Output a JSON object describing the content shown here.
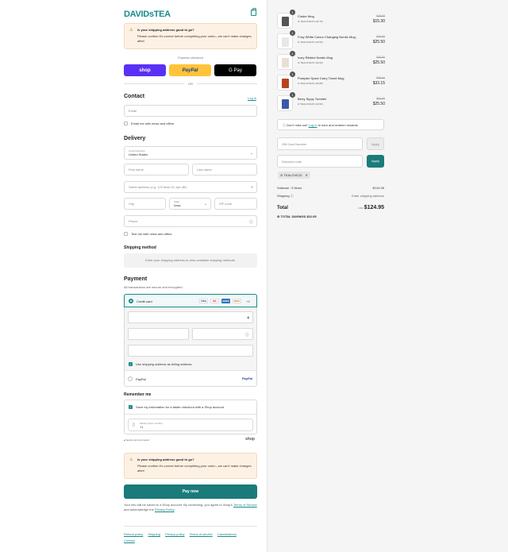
{
  "header": {
    "logo": "DAVIDsTEA",
    "bag_icon": "shopping-bag-icon"
  },
  "warning": {
    "title": "Is your shipping address good to go?",
    "body": "Please confirm it's correct before completing your order—we can't make changes after!"
  },
  "express": {
    "label": "Express checkout",
    "shop": "shop",
    "paypal": "PayPal",
    "gpay": "G Pay",
    "or": "OR"
  },
  "contact": {
    "heading": "Contact",
    "login_link": "Log in",
    "email_placeholder": "Email",
    "email_news": "Email me with news and offers"
  },
  "delivery": {
    "heading": "Delivery",
    "country_label": "Country/Region",
    "country_value": "United States",
    "first_name": "First name",
    "last_name": "Last name",
    "street": "Street address (e.g. 123 Main St, Apt 4B)",
    "city": "City",
    "state_label": "State",
    "state_value": "Iowa",
    "zip": "ZIP code",
    "phone": "Phone",
    "text_news": "Text me with news and offers"
  },
  "shipping": {
    "heading": "Shipping method",
    "empty": "Enter your shipping address to view available shipping methods."
  },
  "payment": {
    "heading": "Payment",
    "subtitle": "All transactions are secure and encrypted.",
    "credit_card": "Credit card",
    "card_logos": [
      "VISA",
      "MC",
      "AMEX",
      "DISC"
    ],
    "more_cards": "+3",
    "billing_same": "Use shipping address as billing address",
    "paypal": "PayPal",
    "paypal_logo": "PayPal"
  },
  "remember": {
    "heading": "Remember me",
    "save_info": "Save my information for a faster checkout with a Shop account",
    "mobile_label": "Mobile phone number",
    "mobile_value": "+1",
    "secure": "Secure and encrypted",
    "shop_logo": "shop"
  },
  "pay_now": "Pay now",
  "legal": {
    "text1": "Your info will be saved to a Shop account. By continuing, you agree to Shop's",
    "terms": "Terms of Service",
    "text2": "and acknowledge the",
    "privacy": "Privacy Policy",
    "end": "."
  },
  "footer": {
    "links": [
      "Refund policy",
      "Shipping",
      "Privacy policy",
      "Terms of service",
      "Cancellations",
      "Contact"
    ]
  },
  "cart": {
    "items": [
      {
        "qty": "1",
        "name": "Cinder Mug",
        "discount": "TEALOVE15 (-$2.70)",
        "original": "$18.00",
        "price": "$15.30",
        "color": "#555555"
      },
      {
        "qty": "1",
        "name": "Foxy White Colour Changing Nordic Mug -",
        "discount": "TEALOVE15 (-$4.50)",
        "original": "$30.00",
        "price": "$25.50",
        "color": "#e8e8e8"
      },
      {
        "qty": "1",
        "name": "Ivory Ribbed Nordic Mug",
        "discount": "TEALOVE15 (-$4.50)",
        "original": "$30.00",
        "price": "$25.50",
        "color": "#e9e1d0"
      },
      {
        "qty": "1",
        "name": "Pumpkin Spice Carry Travel Mug",
        "discount": "TEALOVE15 (-$5.85)",
        "original": "$39.00",
        "price": "$33.15",
        "color": "#b8441e"
      },
      {
        "qty": "1",
        "name": "Berry Sippy Tumbler",
        "discount": "TEALOVE15 (-$4.50)",
        "original": "$30.00",
        "price": "$25.50",
        "color": "#3b5ba8"
      }
    ],
    "reward": {
      "pre": "Don't miss out!",
      "link": "Log in",
      "post": "to earn and redeem rewards"
    },
    "gift_card_placeholder": "Gift Card Number",
    "discount_placeholder": "Discount code",
    "apply": "Apply",
    "code_tag": "TEALOVE15",
    "subtotal_label": "Subtotal · 5 items",
    "subtotal_value": "$124.95",
    "shipping_label": "Shipping",
    "shipping_value": "Enter shipping address",
    "total_label": "Total",
    "currency": "USD",
    "total_value": "$124.95",
    "savings_label": "TOTAL SAVINGS",
    "savings_value": "$22.05"
  }
}
